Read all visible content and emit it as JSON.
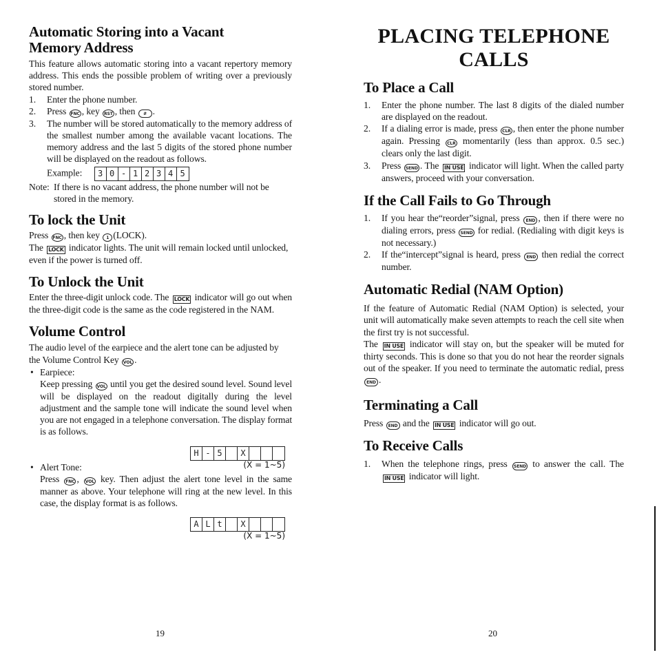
{
  "left_page": {
    "sections": [
      {
        "title_lines": [
          "Automatic Storing into a Vacant",
          "Memory Address"
        ],
        "intro": "This feature allows automatic storing into a vacant repertory memory address. This ends the possible problem of writing over a previously stored number.",
        "steps": [
          {
            "num": "1.",
            "text": "Enter the phone number."
          },
          {
            "num": "2.",
            "pre": "Press ",
            "key1": "FNC",
            "mid1": ", key ",
            "key2": "RST",
            "mid2": ", then ",
            "key3": "#",
            "post": "."
          },
          {
            "num": "3.",
            "text": "The number will be stored automatically to the memory address of the smallest number among the available vacant locations. The memory address and the last 5 digits of the stored phone number will be displayed on the readout as follows."
          }
        ],
        "example_label": "Example:",
        "example_display": [
          "3",
          "0",
          "-",
          "1",
          "2",
          "3",
          "4",
          "5"
        ],
        "note_label": "Note:",
        "note_text": "If there is no vacant address, the phone number will not be stored in the memory."
      },
      {
        "title": "To lock the Unit",
        "line1_pre": "Press ",
        "line1_key": "FNC",
        "line1_mid": ", then key ",
        "line1_key2": "1",
        "line1_post": "(LOCK).",
        "line2_pre": "The ",
        "line2_indicator": "LOCK",
        "line2_post": " indicator lights. The unit will remain locked until unlocked, even if the power is turned off."
      },
      {
        "title": "To Unlock the Unit",
        "pre": "Enter the three-digit unlock code. The ",
        "indicator": "LOCK",
        "post": " indicator will go out when the three-digit code is the same as the code registered in the NAM."
      },
      {
        "title": "Volume Control",
        "intro_pre": "The audio level of the earpiece and the alert tone can be adjusted by the Volume Control Key ",
        "intro_key": "VOL",
        "intro_post": ".",
        "earpiece": {
          "label": "Earpiece:",
          "pre": "Keep pressing ",
          "key": "VOL",
          "post": " until you get the desired sound level. Sound level will be displayed on the readout digitally during the level adjustment and the sample tone will indicate the sound level when you are not engaged in a telephone conversation. The display format is as follows.",
          "display": [
            "H",
            "-",
            "5",
            "",
            "X",
            "",
            "",
            ""
          ],
          "range_note": "(X = 1~5)"
        },
        "alert": {
          "label": "Alert Tone:",
          "pre": "Press ",
          "key1": "FNC",
          "mid": ", ",
          "key2": "VOL",
          "post": " key. Then adjust the alert tone level in the same manner as above. Your telephone will ring at the new level. In this case, the display format is as follows.",
          "display": [
            "A",
            "L",
            "t",
            "",
            "X",
            "",
            "",
            ""
          ],
          "range_note": "(X = 1~5)"
        }
      }
    ],
    "page_number": "19"
  },
  "right_page": {
    "title_lines": [
      "PLACING TELEPHONE",
      "CALLS"
    ],
    "place_call": {
      "title": "To Place a Call",
      "step1": {
        "num": "1.",
        "text": "Enter the phone number. The last 8 digits of the dialed number are displayed on the readout."
      },
      "step2": {
        "num": "2.",
        "pre": "If a dialing error is made, press ",
        "key1": "CLR",
        "mid": ", then enter the phone number again. Pressing ",
        "key2": "CLR",
        "post": " momentarily (less than approx. 0.5 sec.) clears only the last digit."
      },
      "step3": {
        "num": "3.",
        "pre": "Press ",
        "key": "SEND",
        "mid": ". The ",
        "indicator": "IN USE",
        "post": " indicator will light. When the called party answers, proceed with your conversation."
      }
    },
    "call_fails": {
      "title": "If the Call Fails to Go Through",
      "step1": {
        "num": "1.",
        "pre": "If you hear the“reorder”signal, press ",
        "key1": "END",
        "mid": ", then if there were no dialing errors, press ",
        "key2": "SEND",
        "post": " for redial. (Redialing with digit keys is not necessary.)"
      },
      "step2": {
        "num": "2.",
        "pre": "If the“intercept”signal is heard, press ",
        "key": "END",
        "post": " then redial the correct number."
      }
    },
    "auto_redial": {
      "title": "Automatic Redial (NAM Option)",
      "para1": "If the feature of Automatic Redial (NAM Option) is selected, your unit will automatically make seven attempts to reach the cell site when the first try is not successful.",
      "para2_pre": "The ",
      "para2_indicator": "IN USE",
      "para2_post": " indicator will stay on, but the speaker will be muted for thirty seconds. This is done so that you do not hear the reorder signals out of the speaker. If you need to terminate the automatic redial, press ",
      "para2_key": "END",
      "para2_end": "."
    },
    "terminating": {
      "title": "Terminating a Call",
      "pre": "Press ",
      "key": "END",
      "mid": " and the ",
      "indicator": "IN USE",
      "post": " indicator will go out."
    },
    "receive": {
      "title": "To Receive Calls",
      "step1": {
        "num": "1.",
        "pre": "When the telephone rings, press ",
        "key": "SEND",
        "mid": " to answer the call. The ",
        "indicator": "IN USE",
        "post": " indicator will light."
      }
    },
    "page_number": "20"
  }
}
